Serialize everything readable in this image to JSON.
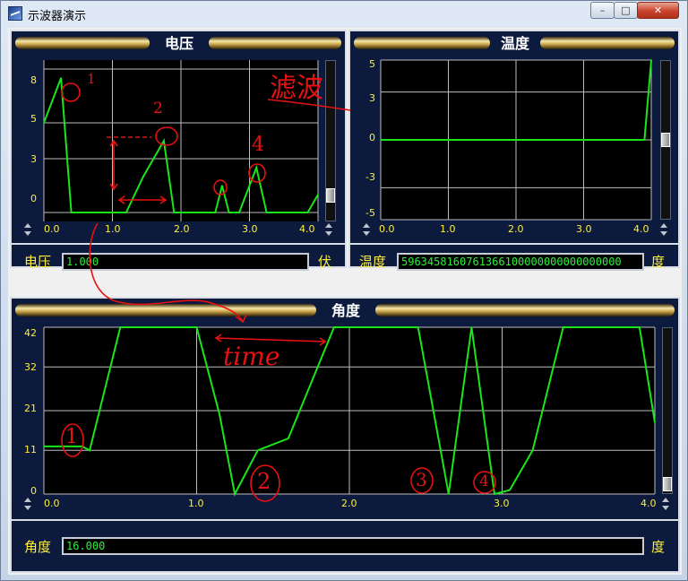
{
  "window": {
    "title": "示波器演示",
    "controls": {
      "minimize": "–",
      "maximize": "□",
      "close": "✕"
    }
  },
  "panels": {
    "voltage": {
      "title": "电压",
      "label": "电压",
      "unit": "伏",
      "readout": "1.000"
    },
    "temperature": {
      "title": "温度",
      "label": "温度",
      "unit": "度",
      "readout": "5963458160761366100000000000000000"
    },
    "angle": {
      "title": "角度",
      "label": "角度",
      "unit": "度",
      "readout": "16.000"
    }
  },
  "annotations": {
    "filter": "滤波",
    "time": "time",
    "v1": "1",
    "v2": "2",
    "v4": "4",
    "a1": "1",
    "a2": "2",
    "a3": "3",
    "a4": "4"
  },
  "chart_data": [
    {
      "type": "line",
      "name": "voltage",
      "x": [
        0.0,
        0.25,
        0.4,
        0.5,
        0.7,
        1.0,
        1.2,
        1.45,
        1.75,
        1.9,
        2.2,
        2.5,
        2.6,
        2.7,
        2.85,
        3.1,
        3.25,
        3.5,
        3.85,
        4.0
      ],
      "values": [
        5,
        7.5,
        0,
        0,
        0,
        0,
        0,
        2,
        4,
        0,
        0,
        0,
        1.5,
        0,
        0,
        2.5,
        0,
        0,
        0,
        1
      ],
      "xticks": [
        "0.0",
        "1.0",
        "2.0",
        "3.0",
        "4.0"
      ],
      "yticks": [
        "8",
        "5",
        "3",
        "0"
      ],
      "xlim": [
        0,
        4
      ],
      "ylim": [
        -0.5,
        8.5
      ],
      "color": "#19e619",
      "grid": true
    },
    {
      "type": "line",
      "name": "temperature",
      "x": [
        0.0,
        3.9,
        4.0
      ],
      "values": [
        0,
        0,
        5
      ],
      "xticks": [
        "0.0",
        "1.0",
        "2.0",
        "3.0",
        "4.0"
      ],
      "yticks": [
        "5",
        "3",
        "0",
        "-3",
        "-5"
      ],
      "xlim": [
        0,
        4
      ],
      "ylim": [
        -5,
        5
      ],
      "color": "#19e619",
      "grid": true
    },
    {
      "type": "line",
      "name": "angle",
      "x": [
        0.0,
        0.25,
        0.3,
        0.5,
        1.0,
        1.15,
        1.25,
        1.4,
        1.6,
        1.9,
        2.0,
        2.45,
        2.65,
        2.8,
        2.95,
        3.05,
        3.2,
        3.4,
        3.55,
        3.9,
        4.0
      ],
      "values": [
        12,
        12,
        11,
        42,
        42,
        20,
        0,
        11,
        14,
        42,
        42,
        42,
        0,
        42,
        0,
        1,
        11,
        42,
        42,
        42,
        18
      ],
      "xticks": [
        "0.0",
        "1.0",
        "2.0",
        "3.0",
        "4.0"
      ],
      "yticks": [
        "42",
        "32",
        "21",
        "11",
        "0"
      ],
      "xlim": [
        0,
        4
      ],
      "ylim": [
        0,
        42
      ],
      "color": "#19e619",
      "grid": true
    }
  ]
}
